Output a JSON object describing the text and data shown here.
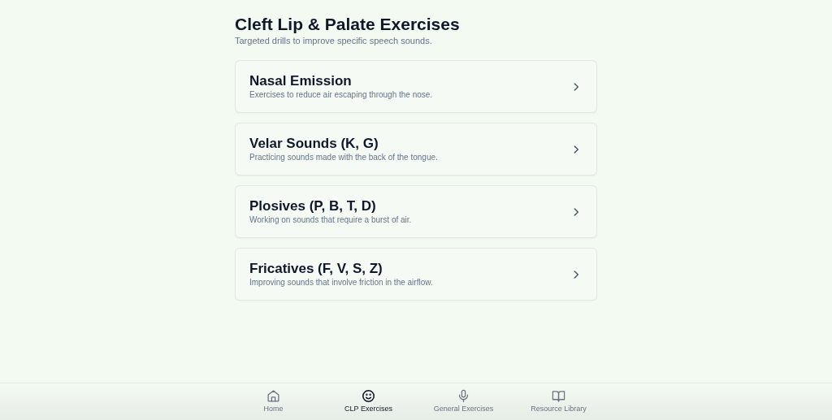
{
  "header": {
    "title": "Cleft Lip & Palate Exercises",
    "subtitle": "Targeted drills to improve specific speech sounds."
  },
  "exercises": [
    {
      "title": "Nasal Emission",
      "description": "Exercises to reduce air escaping through the nose."
    },
    {
      "title": "Velar Sounds (K, G)",
      "description": "Practicing sounds made with the back of the tongue."
    },
    {
      "title": "Plosives (P, B, T, D)",
      "description": "Working on sounds that require a burst of air."
    },
    {
      "title": "Fricatives (F, V, S, Z)",
      "description": "Improving sounds that involve friction in the airflow."
    }
  ],
  "bottom_nav": [
    {
      "label": "Home",
      "kind": "home",
      "selected": false
    },
    {
      "label": "CLP Exercises",
      "kind": "smile",
      "selected": true
    },
    {
      "label": "General Exercises",
      "kind": "mic",
      "selected": false
    },
    {
      "label": "Resource Library",
      "kind": "book",
      "selected": false
    }
  ]
}
